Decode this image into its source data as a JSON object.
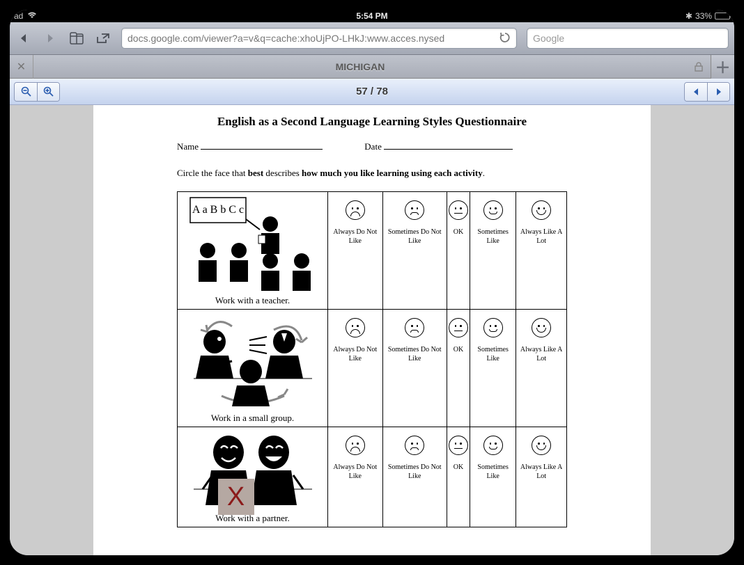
{
  "status": {
    "carrier": "ad",
    "time": "5:54 PM",
    "battery_pct": "33%",
    "bt_icon": "✱"
  },
  "browser": {
    "url": "docs.google.com/viewer?a=v&q=cache:xhoUjPO-LHkJ:www.acces.nysed",
    "search_placeholder": "Google",
    "tab_title": "MICHIGAN"
  },
  "viewer": {
    "page_counter": "57 / 78"
  },
  "doc": {
    "title": "English as a Second Language Learning Styles Questionnaire",
    "name_label": "Name",
    "date_label": "Date",
    "instruction_pre": "Circle the face that ",
    "instruction_bold1": "best",
    "instruction_mid": " describes ",
    "instruction_bold2": "how much you like learning using each activity",
    "instruction_post": ".",
    "board_text": "A a B b C c",
    "ratings": [
      "Always Do Not Like",
      "Sometimes Do Not Like",
      "OK",
      "Sometimes Like",
      "Always Like A Lot"
    ],
    "activities": [
      "Work with a teacher.",
      "Work in a small group.",
      "Work with a partner."
    ]
  }
}
